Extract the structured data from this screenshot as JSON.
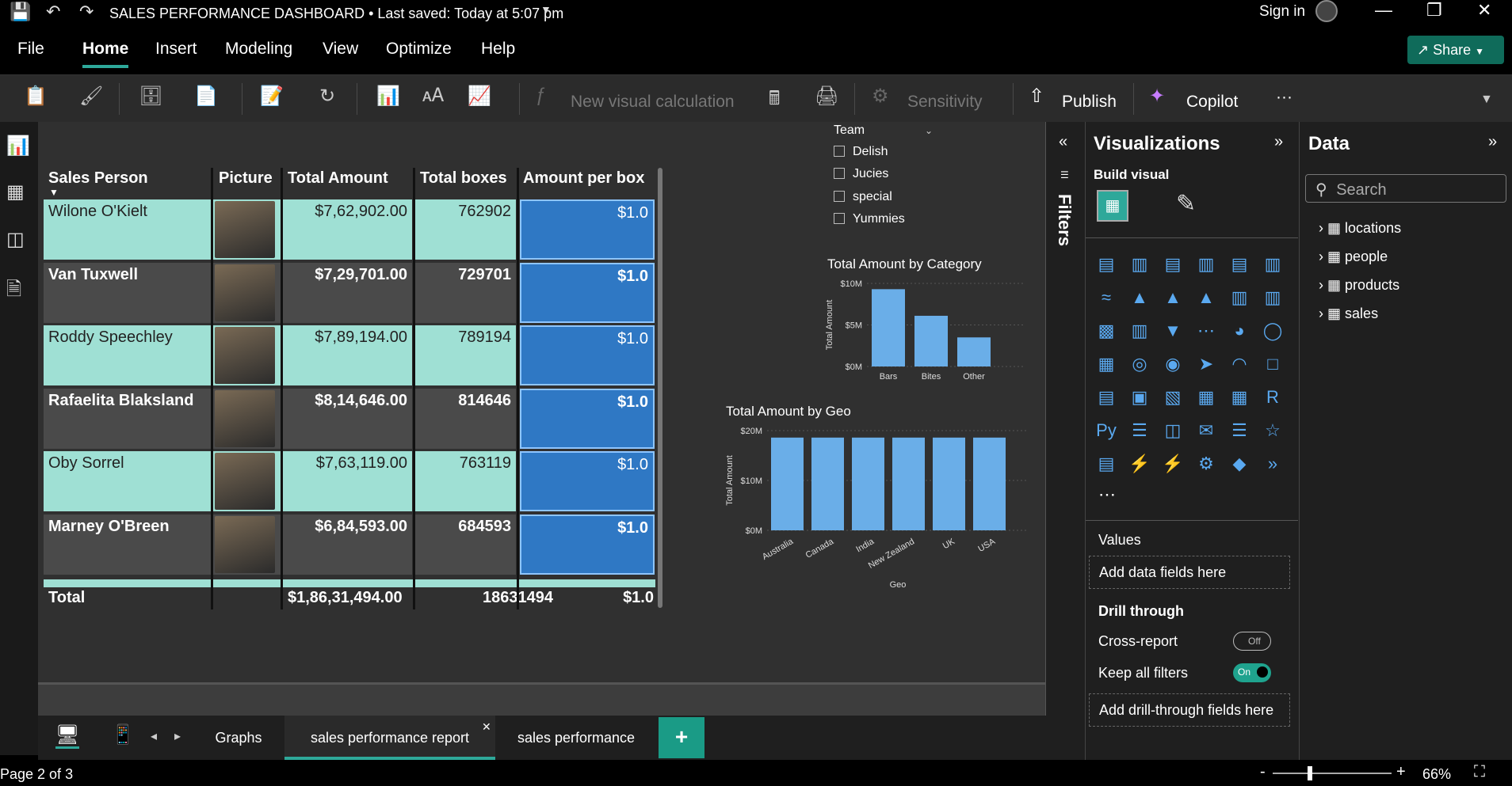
{
  "window": {
    "title": "SALES PERFORMANCE DASHBOARD • Last saved: Today at 5:07 pm",
    "sign_in": "Sign in"
  },
  "menu": {
    "items": [
      "File",
      "Home",
      "Insert",
      "Modeling",
      "View",
      "Optimize",
      "Help"
    ],
    "share": "Share"
  },
  "ribbon": {
    "new_visual_calc": "New visual calculation",
    "sensitivity": "Sensitivity",
    "publish": "Publish",
    "copilot": "Copilot",
    "more": "···"
  },
  "table": {
    "headers": [
      "Sales Person",
      "Picture",
      "Total Amount",
      "Total boxes",
      "Amount per box"
    ],
    "rows": [
      {
        "name": "Wilone O'Kielt",
        "amount": "$7,62,902.00",
        "boxes": "762902",
        "per_box": "$1.0"
      },
      {
        "name": "Van Tuxwell",
        "amount": "$7,29,701.00",
        "boxes": "729701",
        "per_box": "$1.0"
      },
      {
        "name": "Roddy Speechley",
        "amount": "$7,89,194.00",
        "boxes": "789194",
        "per_box": "$1.0"
      },
      {
        "name": "Rafaelita Blaksland",
        "amount": "$8,14,646.00",
        "boxes": "814646",
        "per_box": "$1.0"
      },
      {
        "name": "Oby Sorrel",
        "amount": "$7,63,119.00",
        "boxes": "763119",
        "per_box": "$1.0"
      },
      {
        "name": "Marney O'Breen",
        "amount": "$6,84,593.00",
        "boxes": "684593",
        "per_box": "$1.0"
      }
    ],
    "total": {
      "label": "Total",
      "amount": "$1,86,31,494.00",
      "boxes": "18631494",
      "per_box": "$1.0"
    }
  },
  "slicer": {
    "title": "Team",
    "options": [
      "Delish",
      "Jucies",
      "special",
      "Yummies"
    ]
  },
  "chart_data": [
    {
      "type": "bar",
      "title": "Total Amount by Category",
      "xlabel": "",
      "ylabel": "Total Amount",
      "categories": [
        "Bars",
        "Bites",
        "Other"
      ],
      "values": [
        9.3,
        6.1,
        3.5
      ],
      "yticks": [
        "$10M",
        "$5M",
        "$0M"
      ],
      "ylim": [
        0,
        10
      ]
    },
    {
      "type": "bar",
      "title": "Total Amount by Geo",
      "xlabel": "Geo",
      "ylabel": "Total Amount",
      "categories": [
        "Australia",
        "Canada",
        "India",
        "New Zealand",
        "UK",
        "USA"
      ],
      "values": [
        18.6,
        18.6,
        18.6,
        18.6,
        18.6,
        18.6
      ],
      "yticks": [
        "$20M",
        "$10M",
        "$0M"
      ],
      "ylim": [
        0,
        20
      ]
    }
  ],
  "filters": {
    "label": "Filters"
  },
  "visualizations": {
    "title": "Visualizations",
    "build_visual": "Build visual",
    "values_label": "Values",
    "values_drop": "Add data fields here",
    "drill_through": "Drill through",
    "cross_report": "Cross-report",
    "cross_report_state": "Off",
    "keep_filters": "Keep all filters",
    "keep_filters_state": "On",
    "drill_drop": "Add drill-through fields here"
  },
  "data_pane": {
    "title": "Data",
    "search_placeholder": "Search",
    "tables": [
      "locations",
      "people",
      "products",
      "sales"
    ]
  },
  "pages": {
    "tabs": [
      "Graphs",
      "sales performance report",
      "sales performance"
    ],
    "active": "sales performance report",
    "add": "+"
  },
  "status": {
    "page": "Page 2 of 3",
    "zoom": "66%"
  }
}
